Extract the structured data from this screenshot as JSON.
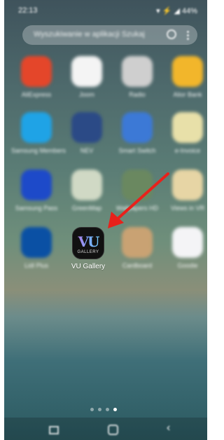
{
  "status_bar": {
    "time": "22:13",
    "icons": "▾ ⚡ ◢ 44%"
  },
  "search": {
    "placeholder": "Wyszukiwanie w aplikacji Szukaj"
  },
  "apps": [
    {
      "label": "AliExpress",
      "color": "#e4462a"
    },
    {
      "label": "Joom",
      "color": "#f4f4f4"
    },
    {
      "label": "Radio",
      "color": "#cfcfcf"
    },
    {
      "label": "Alior Bank",
      "color": "#f2b62b"
    },
    {
      "label": "Samsung Members",
      "color": "#1fa3e6"
    },
    {
      "label": "NEV",
      "color": "#2b4a86"
    },
    {
      "label": "Smart Switch",
      "color": "#3c79d6"
    },
    {
      "label": "e-Invoice",
      "color": "#e8e0a9"
    },
    {
      "label": "Samsung Pass",
      "color": "#1d4ac9"
    },
    {
      "label": "GreenMap",
      "color": "#d0d9c5"
    },
    {
      "label": "Wallpapers HD",
      "color": "#6a8860"
    },
    {
      "label": "Views in VR",
      "color": "#e7d5a5"
    },
    {
      "label": "Lidl Plus",
      "color": "#0a50a4"
    },
    {
      "label": "VU Gallery",
      "color": "#111111"
    },
    {
      "label": "Cardboard",
      "color": "#c9a273"
    },
    {
      "label": "Goodie",
      "color": "#f4f4f6"
    }
  ],
  "vu_gallery": {
    "logo": "VU",
    "sub": "GALLERY"
  },
  "arrow_color": "#e8211b",
  "pages": {
    "count": 4,
    "active": 3
  }
}
